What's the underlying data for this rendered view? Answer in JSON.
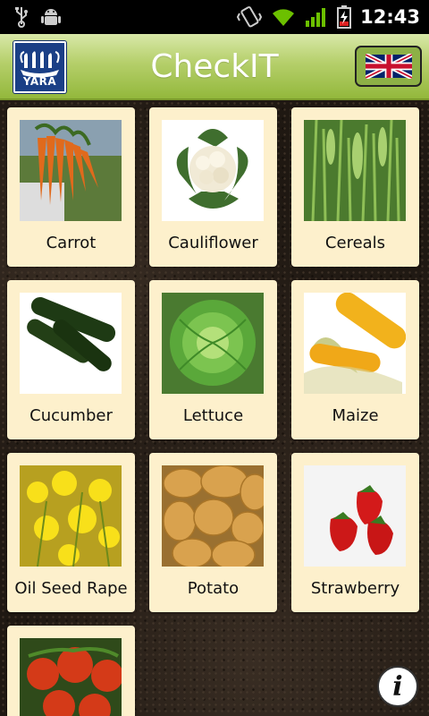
{
  "status_bar": {
    "time": "12:43",
    "icons": [
      "usb-icon",
      "android-debug-icon",
      "vibrate-icon",
      "wifi-icon",
      "signal-icon",
      "battery-charging-icon"
    ]
  },
  "header": {
    "title": "CheckIT",
    "logo_text": "YARA",
    "language_flag": "uk-flag-icon"
  },
  "crops": [
    {
      "label": "Carrot"
    },
    {
      "label": "Cauliflower"
    },
    {
      "label": "Cereals"
    },
    {
      "label": "Cucumber"
    },
    {
      "label": "Lettuce"
    },
    {
      "label": "Maize"
    },
    {
      "label": "Oil Seed Rape"
    },
    {
      "label": "Potato"
    },
    {
      "label": "Strawberry"
    },
    {
      "label": ""
    }
  ],
  "info_button": {
    "icon": "info-icon",
    "glyph": "i"
  },
  "colors": {
    "header_green": "#b5cf6a",
    "tile_bg": "#fdf0cc",
    "logo_blue": "#1a3f86"
  }
}
